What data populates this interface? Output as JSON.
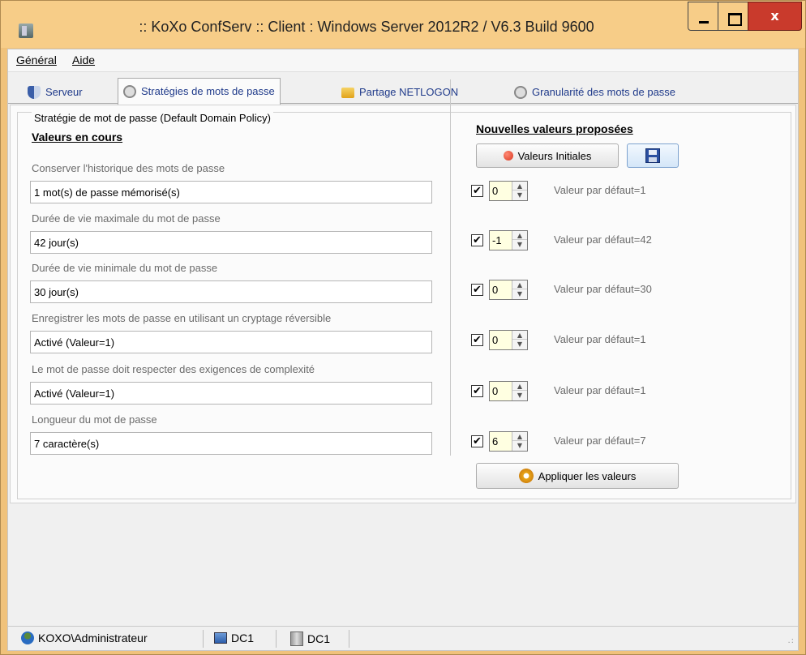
{
  "window": {
    "title": ":: KoXo ConfServ :: Client : Windows Server 2012R2 / V6.3 Build 9600",
    "close_label": "x"
  },
  "menu": {
    "items": [
      {
        "label": "Général"
      },
      {
        "label": "Aide"
      }
    ]
  },
  "tabs": [
    {
      "label": "Serveur",
      "icon": "shield-icon"
    },
    {
      "label": "Stratégies de mots de passe",
      "icon": "lock-icon",
      "active": true
    },
    {
      "label": "Partage NETLOGON",
      "icon": "folder-icon"
    },
    {
      "label": "Granularité des mots de passe",
      "icon": "lock-icon"
    }
  ],
  "group": {
    "title": "Stratégie de mot de passe (Default Domain Policy)"
  },
  "current": {
    "heading": "Valeurs en cours",
    "fields": [
      {
        "label": "Conserver l'historique des mots de passe",
        "value": "1 mot(s) de passe mémorisé(s)"
      },
      {
        "label": "Durée de vie maximale du mot de passe",
        "value": "42 jour(s)"
      },
      {
        "label": "Durée de vie minimale du mot de passe",
        "value": "30 jour(s)"
      },
      {
        "label": "Enregistrer les mots de passe en utilisant un cryptage réversible",
        "value": "Activé (Valeur=1)"
      },
      {
        "label": "Le mot de passe doit respecter des exigences de complexité",
        "value": "Activé (Valeur=1)"
      },
      {
        "label": "Longueur du mot de passe",
        "value": "7 caractère(s)"
      }
    ]
  },
  "proposed": {
    "heading": "Nouvelles valeurs proposées",
    "reset_label": "Valeurs Initiales",
    "apply_label": "Appliquer les valeurs",
    "rows": [
      {
        "checked": true,
        "value": "0",
        "default_label": "Valeur par défaut=1"
      },
      {
        "checked": true,
        "value": "-1",
        "default_label": "Valeur par défaut=42"
      },
      {
        "checked": true,
        "value": "0",
        "default_label": "Valeur par défaut=30"
      },
      {
        "checked": true,
        "value": "0",
        "default_label": "Valeur par défaut=1"
      },
      {
        "checked": true,
        "value": "0",
        "default_label": "Valeur par défaut=1"
      },
      {
        "checked": true,
        "value": "6",
        "default_label": "Valeur par défaut=7"
      }
    ]
  },
  "statusbar": {
    "user": "KOXO\\Administrateur",
    "computer": "DC1",
    "server": "DC1"
  },
  "colors": {
    "title_bar": "#f7cd88",
    "close_button": "#c93a2c",
    "tab_text": "#1f3a8a",
    "spin_field": "#ffffe1"
  }
}
